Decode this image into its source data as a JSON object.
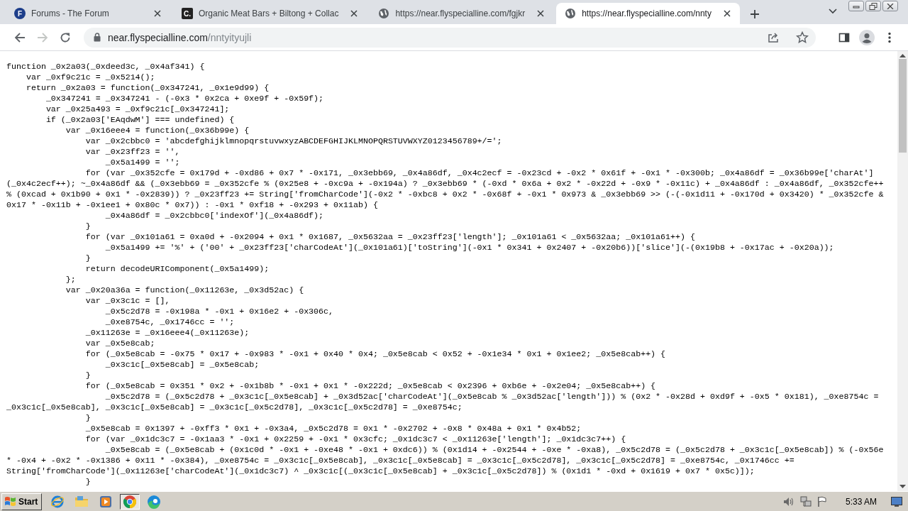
{
  "browser": {
    "tabs": [
      {
        "kind": "letter-circle",
        "favicon_text": "F",
        "title": "Forums - The Forum",
        "selected": false
      },
      {
        "kind": "letter-square",
        "favicon_text": "C.",
        "title": "Organic Meat Bars + Biltong + Collac",
        "selected": false
      },
      {
        "kind": "globe",
        "title": "https://near.flyspecialline.com/fgjkr",
        "selected": false
      },
      {
        "kind": "globe",
        "title": "https://near.flyspecialline.com/nnty",
        "selected": true
      }
    ],
    "navigation": {
      "back_enabled": true,
      "forward_enabled": false
    },
    "address": {
      "host": "near.flyspecialline.com",
      "path": "/nntyityujli"
    }
  },
  "code_lines": [
    "function _0x2a03(_0xdeed3c, _0x4af341) {",
    "    var _0xf9c21c = _0x5214();",
    "    return _0x2a03 = function(_0x347241, _0x1e9d99) {",
    "        _0x347241 = _0x347241 - (-0x3 * 0x2ca + 0xe9f + -0x59f);",
    "        var _0x25a493 = _0xf9c21c[_0x347241];",
    "        if (_0x2a03['EAqdwM'] === undefined) {",
    "            var _0x16eee4 = function(_0x36b99e) {",
    "                var _0x2cbbc0 = 'abcdefghijklmnopqrstuvwxyzABCDEFGHIJKLMNOPQRSTUVWXYZ0123456789+/=';",
    "                var _0x23ff23 = '',",
    "                    _0x5a1499 = '';",
    "                for (var _0x352cfe = 0x179d + -0xd86 + 0x7 * -0x171, _0x3ebb69, _0x4a86df, _0x4c2ecf = -0x23cd + -0x2 * 0x61f + -0x1 * -0x300b; _0x4a86df = _0x36b99e['charAt']",
    "(_0x4c2ecf++); ~_0x4a86df && (_0x3ebb69 = _0x352cfe % (0x25e8 + -0xc9a + -0x194a) ? _0x3ebb69 * (-0xd * 0x6a + 0x2 * -0x22d + -0x9 * -0x11c) + _0x4a86df : _0x4a86df, _0x352cfe++",
    "% (0xcad + 0x1b90 + 0x1 * -0x2839)) ? _0x23ff23 += String['fromCharCode'](-0x2 * -0xbc8 + 0x2 * -0x68f + -0x1 * 0x973 & _0x3ebb69 >> (-(-0x1d11 + -0x170d + 0x3420) * _0x352cfe &",
    "0x17 * -0x11b + -0x1ee1 + 0x80c * 0x7)) : -0x1 * 0xf18 + -0x293 + 0x11ab) {",
    "                    _0x4a86df = _0x2cbbc0['indexOf'](_0x4a86df);",
    "                }",
    "                for (var _0x101a61 = 0xa0d + -0x2094 + 0x1 * 0x1687, _0x5632aa = _0x23ff23['length']; _0x101a61 < _0x5632aa; _0x101a61++) {",
    "                    _0x5a1499 += '%' + ('00' + _0x23ff23['charCodeAt'](_0x101a61)['toString'](-0x1 * 0x341 + 0x2407 + -0x20b6))['slice'](-(0x19b8 + -0x17ac + -0x20a));",
    "                }",
    "                return decodeURIComponent(_0x5a1499);",
    "            };",
    "            var _0x20a36a = function(_0x11263e, _0x3d52ac) {",
    "                var _0x3c1c = [],",
    "                    _0x5c2d78 = -0x198a * -0x1 + 0x16e2 + -0x306c,",
    "                    _0xe8754c, _0x1746cc = '';",
    "                _0x11263e = _0x16eee4(_0x11263e);",
    "                var _0x5e8cab;",
    "                for (_0x5e8cab = -0x75 * 0x17 + -0x983 * -0x1 + 0x40 * 0x4; _0x5e8cab < 0x52 + -0x1e34 * 0x1 + 0x1ee2; _0x5e8cab++) {",
    "                    _0x3c1c[_0x5e8cab] = _0x5e8cab;",
    "                }",
    "                for (_0x5e8cab = 0x351 * 0x2 + -0x1b8b * -0x1 + 0x1 * -0x222d; _0x5e8cab < 0x2396 + 0xb6e + -0x2e04; _0x5e8cab++) {",
    "                    _0x5c2d78 = (_0x5c2d78 + _0x3c1c[_0x5e8cab] + _0x3d52ac['charCodeAt'](_0x5e8cab % _0x3d52ac['length'])) % (0x2 * -0x28d + 0xd9f + -0x5 * 0x181), _0xe8754c =",
    "_0x3c1c[_0x5e8cab], _0x3c1c[_0x5e8cab] = _0x3c1c[_0x5c2d78], _0x3c1c[_0x5c2d78] = _0xe8754c;",
    "                }",
    "                _0x5e8cab = 0x1397 + -0xff3 * 0x1 + -0x3a4, _0x5c2d78 = 0x1 * -0x2702 + -0x8 * 0x48a + 0x1 * 0x4b52;",
    "                for (var _0x1dc3c7 = -0x1aa3 * -0x1 + 0x2259 + -0x1 * 0x3cfc; _0x1dc3c7 < _0x11263e['length']; _0x1dc3c7++) {",
    "                    _0x5e8cab = (_0x5e8cab + (0x1c0d * -0x1 + -0xe48 * -0x1 + 0xdc6)) % (0x1d14 + -0x2544 + -0xe * -0xa8), _0x5c2d78 = (_0x5c2d78 + _0x3c1c[_0x5e8cab]) % (-0x56e",
    "* -0x4 + -0x2 * -0x1386 + 0x11 * -0x384), _0xe8754c = _0x3c1c[_0x5e8cab], _0x3c1c[_0x5e8cab] = _0x3c1c[_0x5c2d78], _0x3c1c[_0x5c2d78] = _0xe8754c, _0x1746cc +=",
    "String['fromCharCode'](_0x11263e['charCodeAt'](_0x1dc3c7) ^ _0x3c1c[(_0x3c1c[_0x5e8cab] + _0x3c1c[_0x5c2d78]) % (0x1d1 * -0xd + 0x1619 + 0x7 * 0x5c)]);",
    "                }"
  ],
  "taskbar": {
    "start_label": "Start",
    "apps": [
      {
        "kind": "ie",
        "active": false
      },
      {
        "kind": "folder",
        "active": false
      },
      {
        "kind": "media",
        "active": false
      },
      {
        "kind": "chrome",
        "active": true
      },
      {
        "kind": "edge",
        "active": false
      }
    ],
    "clock": "5:33 AM"
  }
}
